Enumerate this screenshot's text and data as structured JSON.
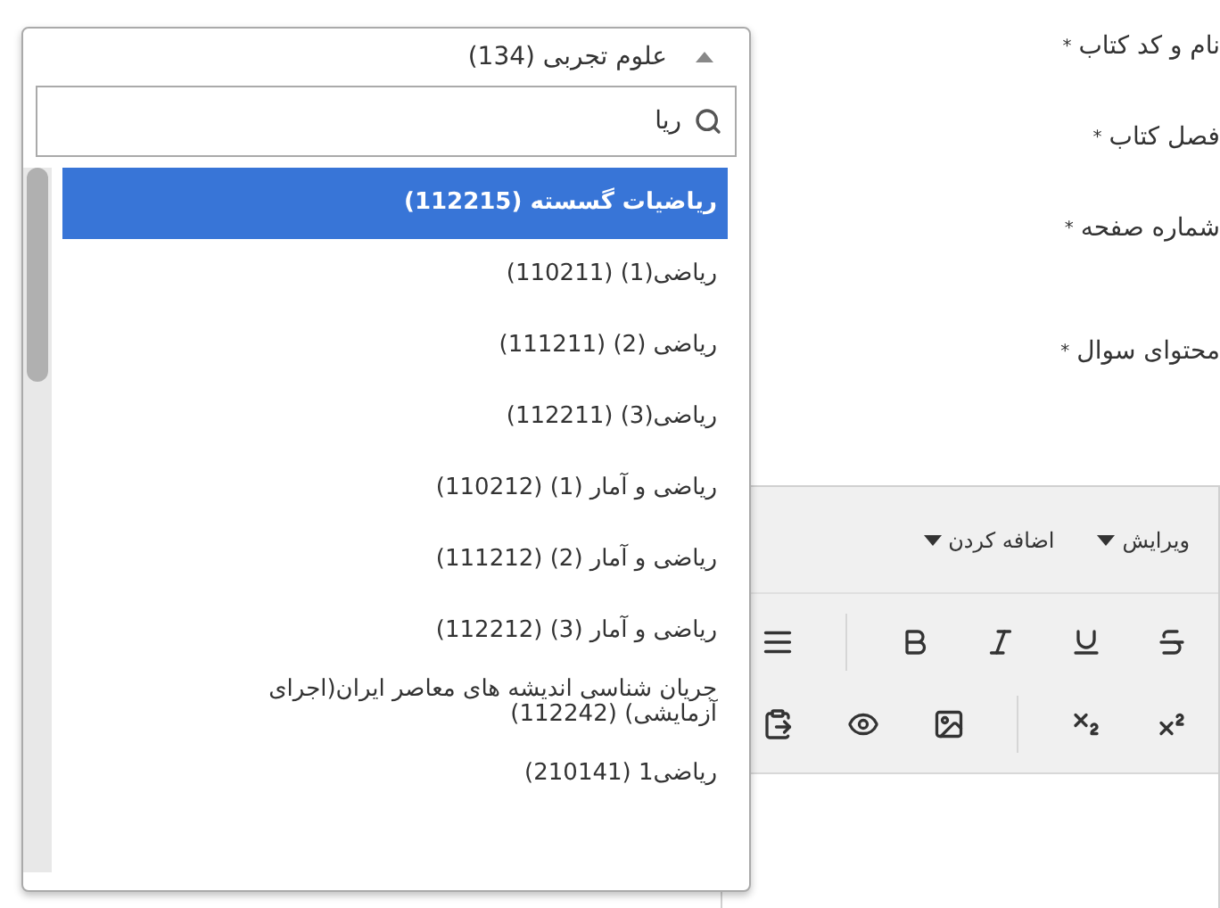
{
  "form_labels": [
    {
      "text": "نام و کد کتاب",
      "required_mark": "*"
    },
    {
      "text": "فصل کتاب",
      "required_mark": "*"
    },
    {
      "text": "شماره صفحه",
      "required_mark": "*"
    },
    {
      "text": "محتوای سوال",
      "required_mark": "*"
    }
  ],
  "editor": {
    "menus": [
      "ویرایش",
      "اضافه کردن"
    ],
    "toolbar_row_1": [
      {
        "kind": "justify"
      },
      {
        "kind": "separator"
      },
      {
        "kind": "bold"
      },
      {
        "kind": "italic"
      },
      {
        "kind": "underline"
      },
      {
        "kind": "strike"
      }
    ],
    "toolbar_row_2": [
      {
        "kind": "paste"
      },
      {
        "kind": "preview"
      },
      {
        "kind": "image"
      },
      {
        "kind": "separator"
      },
      {
        "kind": "subscript"
      },
      {
        "kind": "superscript"
      }
    ]
  },
  "dropdown": {
    "selected_value": "علوم تجربی (134)",
    "expanded": true,
    "search": {
      "value": "ریا"
    },
    "options": [
      {
        "label": "ریاضیات گسسته (112215)",
        "selected": true
      },
      {
        "label": "ریاضی(1) (110211)",
        "selected": false
      },
      {
        "label": "ریاضی (2) (111211)",
        "selected": false
      },
      {
        "label": "ریاضی(3) (112211)",
        "selected": false
      },
      {
        "label": "ریاضی و آمار (1) (110212)",
        "selected": false
      },
      {
        "label": "ریاضی و آمار (2) (111212)",
        "selected": false
      },
      {
        "label": "ریاضی و آمار (3) (112212)",
        "selected": false
      },
      {
        "label": "جریان شناسی اندیشه های معاصر ایران(اجرای آزمایشی) (112242)",
        "selected": false
      },
      {
        "label": "ریاضی1 (210141)",
        "selected": false
      }
    ]
  }
}
